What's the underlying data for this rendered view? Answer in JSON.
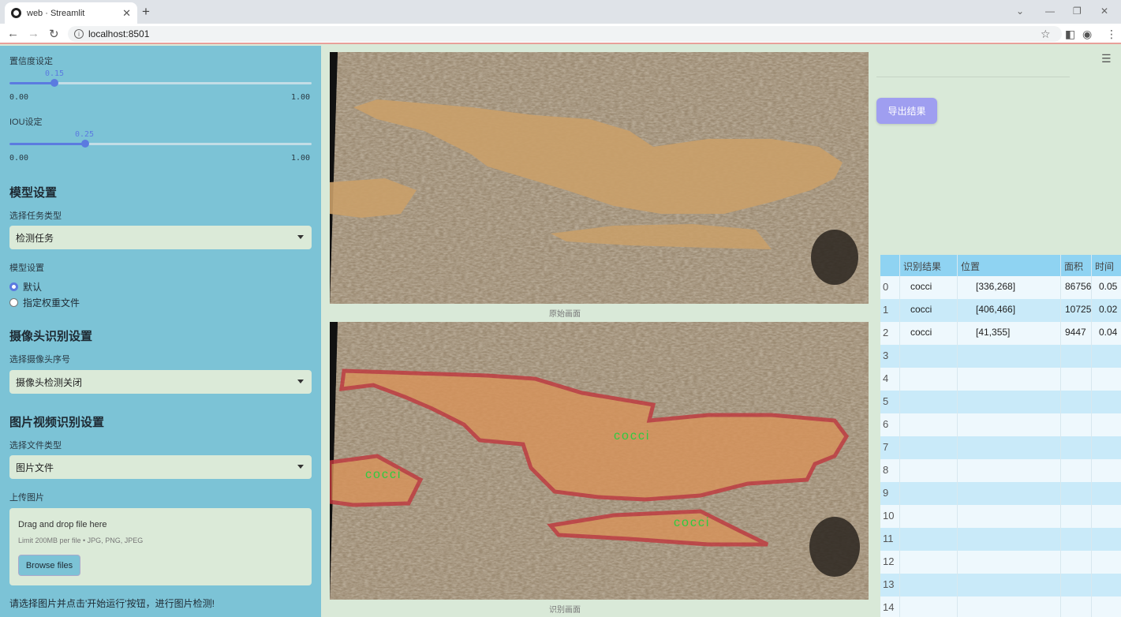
{
  "browser": {
    "tab_title": "web · Streamlit",
    "new_tab": "+",
    "url": "localhost:8501",
    "controls": {
      "minimize": "—",
      "restore": "❐",
      "close": "✕",
      "chevron": "⌄"
    }
  },
  "sidebar": {
    "confidence": {
      "label": "置信度设定",
      "value": "0.15",
      "min": "0.00",
      "max": "1.00",
      "fraction": 0.15
    },
    "iou": {
      "label": "IOU设定",
      "value": "0.25",
      "min": "0.00",
      "max": "1.00",
      "fraction": 0.25
    },
    "model_section": "模型设置",
    "task_type_label": "选择任务类型",
    "task_type_value": "检测任务",
    "model_setting_label": "模型设置",
    "radio_default": "默认",
    "radio_custom": "指定权重文件",
    "camera_section": "摄像头识别设置",
    "camera_label": "选择摄像头序号",
    "camera_value": "摄像头检测关闭",
    "media_section": "图片视频识别设置",
    "file_type_label": "选择文件类型",
    "file_type_value": "图片文件",
    "upload_label": "上传图片",
    "upload_drag": "Drag and drop file here",
    "upload_limit": "Limit 200MB per file • JPG, PNG, JPEG",
    "browse_button": "Browse files",
    "hint": "请选择图片并点击'开始运行'按钮，进行图片检测!"
  },
  "main": {
    "original_caption": "原始画面",
    "result_caption": "识别画面",
    "detections": [
      {
        "label": "cocci"
      },
      {
        "label": "cocci"
      },
      {
        "label": "cocci"
      }
    ]
  },
  "right": {
    "export_button": "导出结果",
    "table": {
      "headers": [
        "识别结果",
        "位置",
        "面积",
        "时间"
      ],
      "rows": [
        {
          "idx": "0",
          "result": "cocci",
          "pos": "[336,268]",
          "area": "86756",
          "time": "0.05"
        },
        {
          "idx": "1",
          "result": "cocci",
          "pos": "[406,466]",
          "area": "10725",
          "time": "0.02"
        },
        {
          "idx": "2",
          "result": "cocci",
          "pos": "[41,355]",
          "area": "9447",
          "time": "0.04"
        },
        {
          "idx": "3",
          "result": "",
          "pos": "",
          "area": "",
          "time": ""
        },
        {
          "idx": "4",
          "result": "",
          "pos": "",
          "area": "",
          "time": ""
        },
        {
          "idx": "5",
          "result": "",
          "pos": "",
          "area": "",
          "time": ""
        },
        {
          "idx": "6",
          "result": "",
          "pos": "",
          "area": "",
          "time": ""
        },
        {
          "idx": "7",
          "result": "",
          "pos": "",
          "area": "",
          "time": ""
        },
        {
          "idx": "8",
          "result": "",
          "pos": "",
          "area": "",
          "time": ""
        },
        {
          "idx": "9",
          "result": "",
          "pos": "",
          "area": "",
          "time": ""
        },
        {
          "idx": "10",
          "result": "",
          "pos": "",
          "area": "",
          "time": ""
        },
        {
          "idx": "11",
          "result": "",
          "pos": "",
          "area": "",
          "time": ""
        },
        {
          "idx": "12",
          "result": "",
          "pos": "",
          "area": "",
          "time": ""
        },
        {
          "idx": "13",
          "result": "",
          "pos": "",
          "area": "",
          "time": ""
        },
        {
          "idx": "14",
          "result": "",
          "pos": "",
          "area": "",
          "time": ""
        }
      ]
    }
  },
  "colors": {
    "sidebar_bg": "#7cc3d6",
    "main_bg": "#d9e9d8",
    "accent": "#5b7be0",
    "export_btn": "#9f9ef0",
    "table_header": "#8fd3f2",
    "mask_outline": "#c0393e",
    "mask_fill": "#d8935a",
    "label_text": "#2ecc40"
  }
}
